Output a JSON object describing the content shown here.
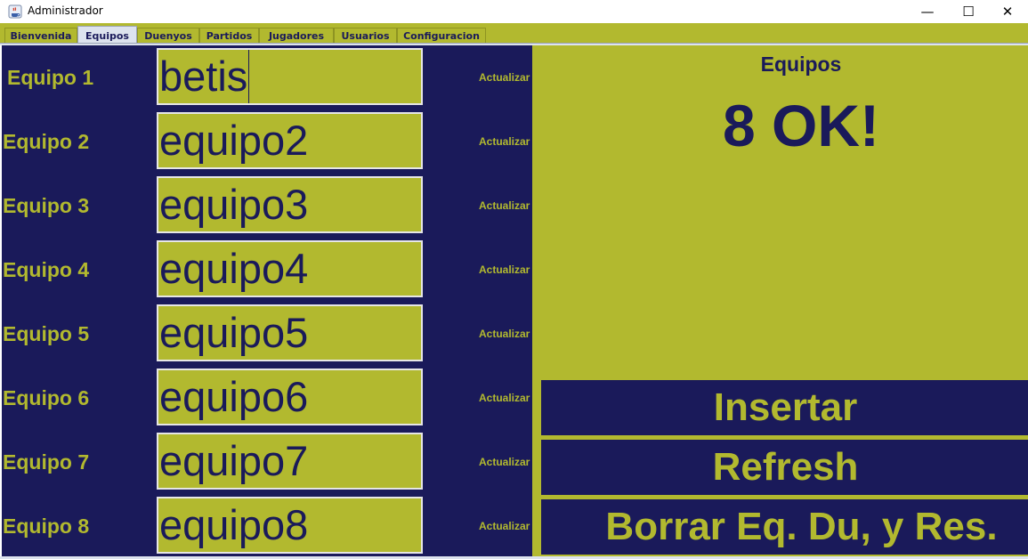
{
  "window": {
    "title": "Administrador",
    "minimize_glyph": "—",
    "maximize_glyph": "☐",
    "close_glyph": "✕",
    "icon": "java-coffee-cup-icon"
  },
  "tabs": [
    {
      "label": "Bienvenida",
      "active": false
    },
    {
      "label": "Equipos",
      "active": true
    },
    {
      "label": "Duenyos",
      "active": false
    },
    {
      "label": "Partidos",
      "active": false
    },
    {
      "label": "Jugadores",
      "active": false
    },
    {
      "label": "Usuarios",
      "active": false
    },
    {
      "label": "Configuracion",
      "active": false
    }
  ],
  "teams": [
    {
      "label": "Equipo 1",
      "value": "betis",
      "action": "Actualizar"
    },
    {
      "label": "Equipo 2",
      "value": "equipo2",
      "action": "Actualizar"
    },
    {
      "label": "Equipo 3",
      "value": "equipo3",
      "action": "Actualizar"
    },
    {
      "label": "Equipo 4",
      "value": "equipo4",
      "action": "Actualizar"
    },
    {
      "label": "Equipo 5",
      "value": "equipo5",
      "action": "Actualizar"
    },
    {
      "label": "Equipo 6",
      "value": "equipo6",
      "action": "Actualizar"
    },
    {
      "label": "Equipo 7",
      "value": "equipo7",
      "action": "Actualizar"
    },
    {
      "label": "Equipo 8",
      "value": "equipo8",
      "action": "Actualizar"
    }
  ],
  "panel": {
    "title": "Equipos",
    "status": "8 OK!",
    "insert_label": "Insertar",
    "refresh_label": "Refresh",
    "delete_label": "Borrar Eq. Du, y Res."
  },
  "colors": {
    "navy": "#1a1a5a",
    "olive": "#b2b92f",
    "field_border": "#e6e6e6"
  }
}
